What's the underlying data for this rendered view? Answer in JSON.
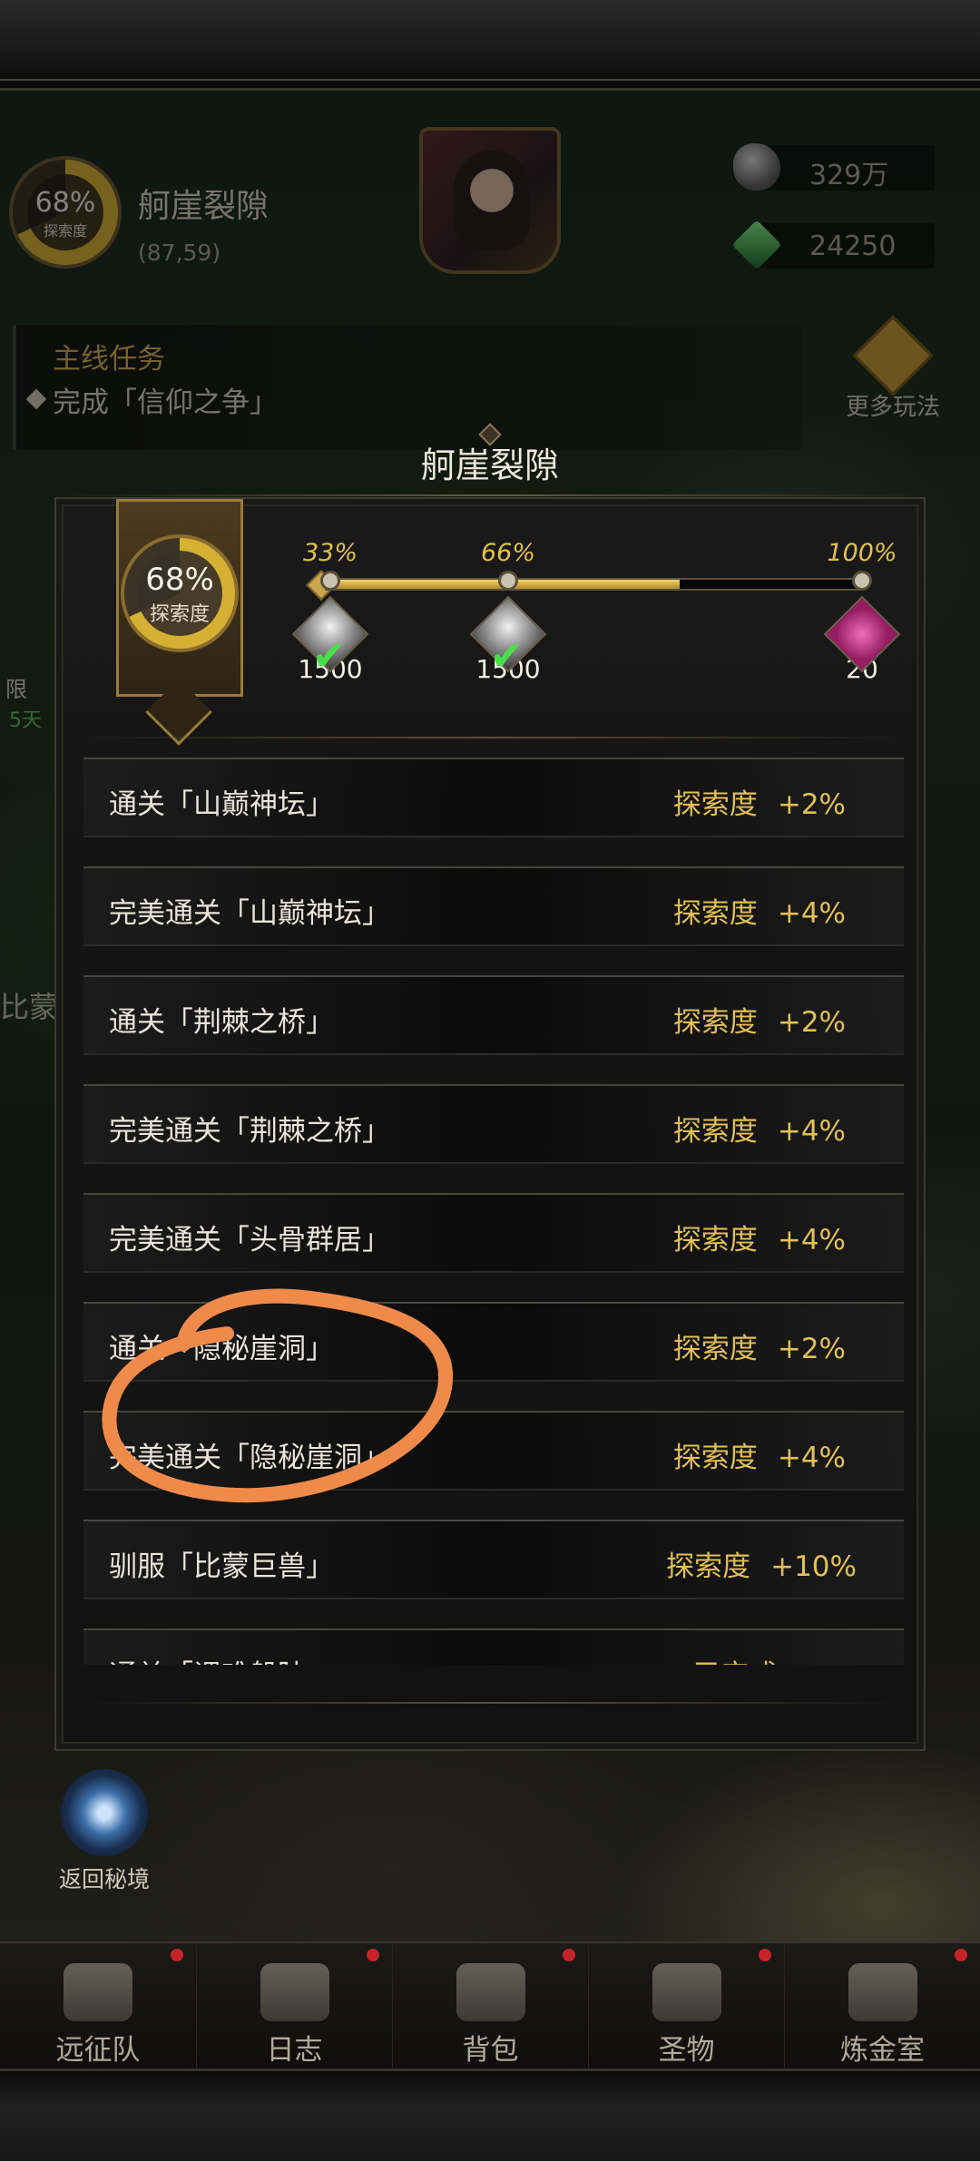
{
  "hud": {
    "explore_pct": "68%",
    "explore_label": "探索度",
    "location_name": "舸崖裂隙",
    "coordinates": "(87,59)",
    "resources": [
      {
        "icon": "stone-icon",
        "value": "329万"
      },
      {
        "icon": "emerald-icon",
        "value": "24250"
      }
    ],
    "quest": {
      "title": "主线任务",
      "description": "完成「信仰之争」"
    },
    "more_label": "更多玩法",
    "left_badge": "限",
    "left_days": "5天",
    "left_name": "比蒙",
    "back_realm": "返回秘境"
  },
  "dialog": {
    "title": "舸崖裂隙",
    "explore_pct": "68%",
    "explore_label": "探索度",
    "progress_fraction": 0.66,
    "milestones": [
      {
        "pct": "33%",
        "reward_icon": "stone-reward-icon",
        "qty": "1500",
        "claimed": true
      },
      {
        "pct": "66%",
        "reward_icon": "stone-reward-icon",
        "qty": "1500",
        "claimed": true
      },
      {
        "pct": "100%",
        "reward_icon": "pink-crystal-icon",
        "qty": "20",
        "claimed": false
      }
    ],
    "tasks": [
      {
        "text": "通关「山巅神坛」",
        "label": "探索度",
        "value": "+2%"
      },
      {
        "text": "完美通关「山巅神坛」",
        "label": "探索度",
        "value": "+4%"
      },
      {
        "text": "通关「荆棘之桥」",
        "label": "探索度",
        "value": "+2%"
      },
      {
        "text": "完美通关「荆棘之桥」",
        "label": "探索度",
        "value": "+4%"
      },
      {
        "text": "完美通关「头骨群居」",
        "label": "探索度",
        "value": "+4%"
      },
      {
        "text": "通关「隐秘崖洞」",
        "label": "探索度",
        "value": "+2%"
      },
      {
        "text": "完美通关「隐秘崖洞」",
        "label": "探索度",
        "value": "+4%"
      },
      {
        "text": "驯服「比蒙巨兽」",
        "label": "探索度",
        "value": "+10%"
      },
      {
        "text": "通关「课难般陆",
        "status": "已完成"
      }
    ]
  },
  "nav": {
    "items": [
      {
        "label": "远征队",
        "icon": "expedition-icon",
        "badge": true
      },
      {
        "label": "日志",
        "icon": "journal-icon",
        "badge": true
      },
      {
        "label": "背包",
        "icon": "backpack-icon",
        "badge": true
      },
      {
        "label": "圣物",
        "icon": "relic-icon",
        "badge": true
      },
      {
        "label": "炼金室",
        "icon": "alchemy-icon",
        "badge": true
      }
    ]
  },
  "colors": {
    "gold": "#e2bf58",
    "annotation": "#f08a4b",
    "badge": "#c6242a"
  }
}
